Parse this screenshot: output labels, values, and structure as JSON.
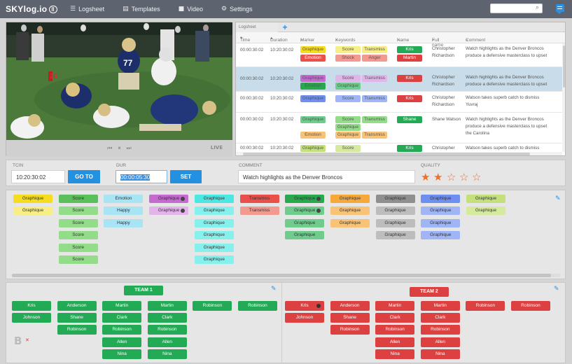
{
  "app": {
    "name": "SKYlog.io"
  },
  "nav": [
    {
      "label": "Logsheet",
      "icon": "list-icon"
    },
    {
      "label": "Templates",
      "icon": "template-icon"
    },
    {
      "label": "Video",
      "icon": "video-camera-icon"
    },
    {
      "label": "Settings",
      "icon": "gear-icon"
    }
  ],
  "video": {
    "live_label": "LIVE"
  },
  "logsheet": {
    "tab_label": "Logsheet",
    "headers": {
      "time": "Time",
      "duration": "Duration",
      "marker": "Marker",
      "keywords": "Keywords",
      "name": "Name",
      "fullname": "Full name",
      "comment": "Comment"
    },
    "rows": [
      {
        "time": "00:00:30:02",
        "duration": "10:20:30:02",
        "markers": [
          "Graphique",
          "Emotion"
        ],
        "keywords": [
          "Score",
          "Transmiss",
          "Shock",
          "Anger"
        ],
        "names": [
          "Kris",
          "Martin"
        ],
        "fullname": [
          "Christopher",
          "Richardson"
        ],
        "comment": [
          "Watch highlights as the Denver Broncos",
          "produce a defensive masterclass to upset"
        ]
      },
      {
        "time": "00:00:30:02",
        "duration": "10:20:30:02",
        "markers": [
          "Graphique",
          "Emotion"
        ],
        "keywords": [
          "Score",
          "Transmiss",
          "Graphique"
        ],
        "names": [
          "Kris"
        ],
        "fullname": [
          "Christopher",
          "Richardson"
        ],
        "comment": [
          "Watch highlights as the Denver Broncos",
          "produce a defensive masterclass to upset"
        ]
      },
      {
        "time": "00:00:30:02",
        "duration": "10:20:30:02",
        "markers": [
          "Graphique"
        ],
        "keywords": [
          "Score",
          "Transmiss"
        ],
        "names": [
          "Kris"
        ],
        "fullname": [
          "Christopher",
          "Richardson"
        ],
        "comment": [
          "Watson takes superb catch to dismiss",
          "Yuvraj"
        ]
      },
      {
        "time": "00:00:30:02",
        "duration": "10:20:30:02",
        "markers": [
          "Graphique",
          "Emotion"
        ],
        "keywords": [
          "Score",
          "Transmiss",
          "Graphique",
          "Graphique",
          "Transmiss"
        ],
        "names": [
          "Shane"
        ],
        "fullname": [
          "Shane Watson"
        ],
        "comment": [
          "Watch highlights as the Denver Broncos",
          "produce a defensive masterclass to upset",
          "the Carolina"
        ]
      },
      {
        "time": "00:00:30:02",
        "duration": "10:20:30:02",
        "markers": [
          "Graphique"
        ],
        "keywords": [
          "Score"
        ],
        "names": [
          "Kris"
        ],
        "fullname": [
          "Christopher"
        ],
        "comment": [
          "Watson takes superb catch to dismiss"
        ]
      }
    ]
  },
  "controls": {
    "tcin_label": "TCIN",
    "tcin_value": "10:20:30:02",
    "goto_label": "GO TO",
    "dur_label": "DUR",
    "dur_value": "00:00:05:30",
    "set_label": "SET",
    "comment_label": "COMMENT",
    "comment_value": "Watch highlights as the Denver Broncos",
    "quality_label": "QUALITY",
    "quality_rating": 2,
    "quality_max": 5
  },
  "marker_columns": [
    {
      "color": "#f5dc1e",
      "light": "#f7ee86",
      "items": [
        "Graphique",
        "Graphique"
      ]
    },
    {
      "color": "#5bbf5b",
      "light": "#93dc8a",
      "items": [
        "Score",
        "Score",
        "Score",
        "Score",
        "Score",
        "Score"
      ]
    },
    {
      "color": "#a8e4f4",
      "light": "#a8e4f4",
      "items": [
        "Emotion",
        "Happy",
        "Happy"
      ]
    },
    {
      "color": "#c46ad1",
      "light": "#e3b4ea",
      "items": [
        "Graphique",
        "Graphique"
      ]
    },
    {
      "color": "#4be7e3",
      "light": "#86f0ed",
      "items": [
        "Graphique",
        "Graphique",
        "Graphique",
        "Graphique",
        "Graphique",
        "Graphique"
      ]
    },
    {
      "color": "#e9504a",
      "light": "#f29a90",
      "items": [
        "Transmiss",
        "Transmiss"
      ]
    },
    {
      "color": "#2aa84e",
      "light": "#6fcc8c",
      "items": [
        "Graphique",
        "Graphique",
        "Graphique",
        "Graphique"
      ]
    },
    {
      "color": "#f6a93a",
      "light": "#f8c377",
      "items": [
        "Graphique",
        "Graphique",
        "Graphique"
      ]
    },
    {
      "color": "#8f8f8f",
      "light": "#bdbdbd",
      "items": [
        "Graphique",
        "Graphique",
        "Graphique",
        "Graphique"
      ]
    },
    {
      "color": "#6f8ff0",
      "light": "#9fb5f6",
      "items": [
        "Graphique",
        "Graphique",
        "Graphique",
        "Graphique"
      ]
    },
    {
      "color": "#c4e07a",
      "light": "#d6ea9e",
      "items": [
        "Graphique",
        "Graphique"
      ]
    }
  ],
  "teams": [
    {
      "name": "TEAM 1",
      "color": "#22aa55",
      "columns": [
        [
          "Kris",
          "Johnson"
        ],
        [
          "Anderson",
          "Shane",
          "Robinson"
        ],
        [
          "Martin",
          "Clark",
          "Robinson",
          "Allen",
          "Nina"
        ],
        [
          "Martin",
          "Clark",
          "Robinson",
          "Allen",
          "Nina"
        ],
        [
          "Robinson"
        ],
        [
          "Robinson"
        ]
      ]
    },
    {
      "name": "TEAM 2",
      "color": "#dd4040",
      "columns": [
        [
          "Kris",
          "Johnson"
        ],
        [
          "Anderson",
          "Shane",
          "Robinson"
        ],
        [
          "Martin",
          "Clark",
          "Robinson",
          "Allen",
          "Nina"
        ],
        [
          "Martin",
          "Clark",
          "Robinson",
          "Allen",
          "Nina"
        ],
        [
          "Robinson"
        ],
        [
          "Robinson"
        ]
      ]
    }
  ]
}
